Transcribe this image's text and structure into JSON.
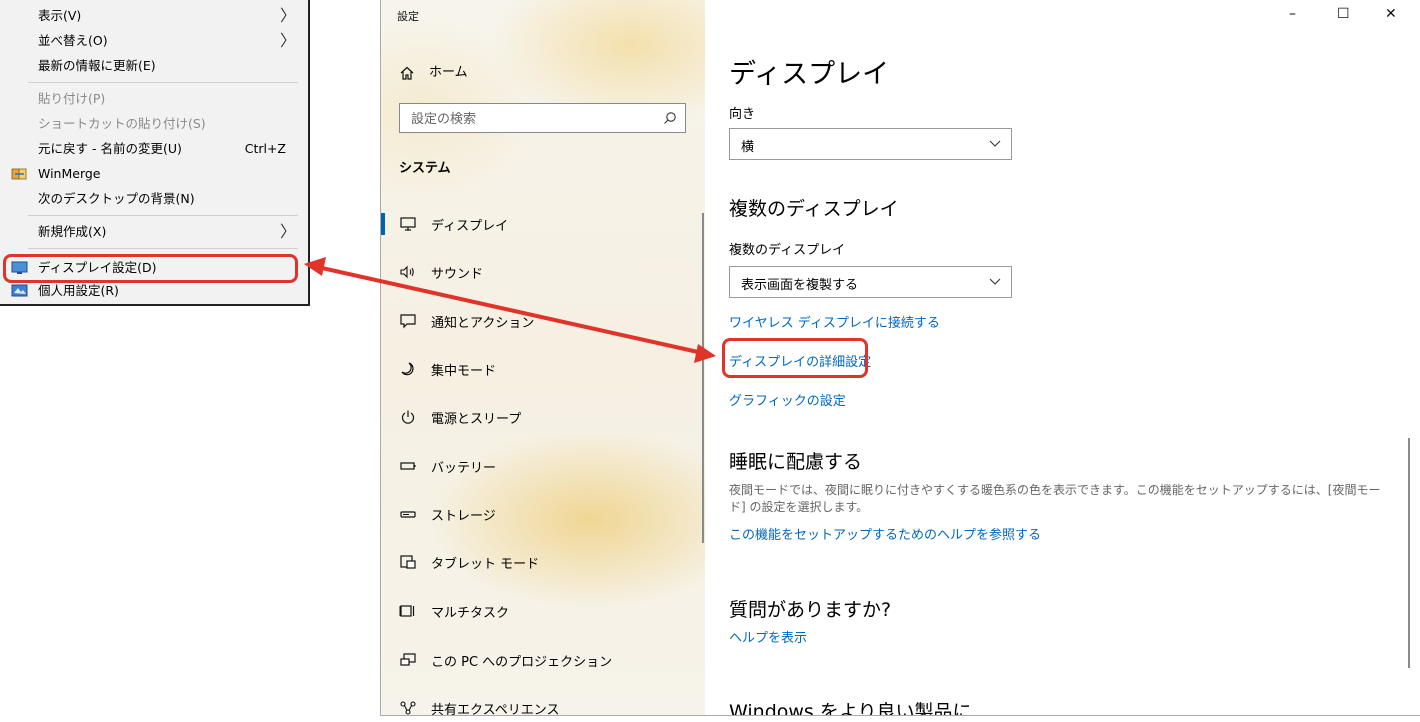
{
  "context_menu": {
    "items": [
      {
        "label": "表示(V)",
        "submenu": true
      },
      {
        "label": "並べ替え(O)",
        "submenu": true
      },
      {
        "label": "最新の情報に更新(E)"
      },
      {
        "label": "貼り付け(P)",
        "disabled": true
      },
      {
        "label": "ショートカットの貼り付け(S)",
        "disabled": true
      },
      {
        "label": "元に戻す - 名前の変更(U)",
        "shortcut": "Ctrl+Z"
      },
      {
        "label": "WinMerge",
        "icon": "winmerge-icon"
      },
      {
        "label": "次のデスクトップの背景(N)"
      },
      {
        "label": "新規作成(X)",
        "submenu": true
      },
      {
        "label": "ディスプレイ設定(D)",
        "icon": "display-settings-icon",
        "highlighted": true
      },
      {
        "label": "個人用設定(R)",
        "icon": "personalize-icon"
      }
    ],
    "submenu_glyph": "〉"
  },
  "window": {
    "title": "設定",
    "controls": {
      "minimize": "–",
      "maximize": "☐",
      "close": "✕"
    }
  },
  "sidebar": {
    "home_label": "ホーム",
    "search_placeholder": "設定の検索",
    "section_title": "システム",
    "items": [
      {
        "label": "ディスプレイ",
        "icon": "monitor-icon",
        "active": true
      },
      {
        "label": "サウンド",
        "icon": "speaker-icon"
      },
      {
        "label": "通知とアクション",
        "icon": "notification-icon"
      },
      {
        "label": "集中モード",
        "icon": "moon-icon"
      },
      {
        "label": "電源とスリープ",
        "icon": "power-icon"
      },
      {
        "label": "バッテリー",
        "icon": "battery-icon"
      },
      {
        "label": "ストレージ",
        "icon": "storage-icon"
      },
      {
        "label": "タブレット モード",
        "icon": "tablet-icon"
      },
      {
        "label": "マルチタスク",
        "icon": "multitask-icon"
      },
      {
        "label": "この PC へのプロジェクション",
        "icon": "projection-icon"
      },
      {
        "label": "共有エクスペリエンス",
        "icon": "share-icon"
      }
    ]
  },
  "content": {
    "page_title": "ディスプレイ",
    "orientation_label": "向き",
    "orientation_value": "横",
    "multi_display_heading": "複数のディスプレイ",
    "multi_display_label": "複数のディスプレイ",
    "multi_display_value": "表示画面を複製する",
    "links": {
      "wireless": "ワイヤレス ディスプレイに接続する",
      "advanced": "ディスプレイの詳細設定",
      "graphics": "グラフィックの設定"
    },
    "sleep_heading": "睡眠に配慮する",
    "sleep_desc": "夜間モードでは、夜間に眠りに付きやすくする暖色系の色を表示できます。この機能をセットアップするには、[夜間モード] の設定を選択します。",
    "sleep_help_link": "この機能をセットアップするためのヘルプを参照する",
    "question_heading": "質問がありますか?",
    "help_link": "ヘルプを表示",
    "windows_heading": "Windows をより良い製品に"
  },
  "annotation": {
    "highlight_color": "#e0332a",
    "arrow": "double-headed"
  },
  "colors": {
    "accent": "#0063b1",
    "link": "#0067c0"
  }
}
